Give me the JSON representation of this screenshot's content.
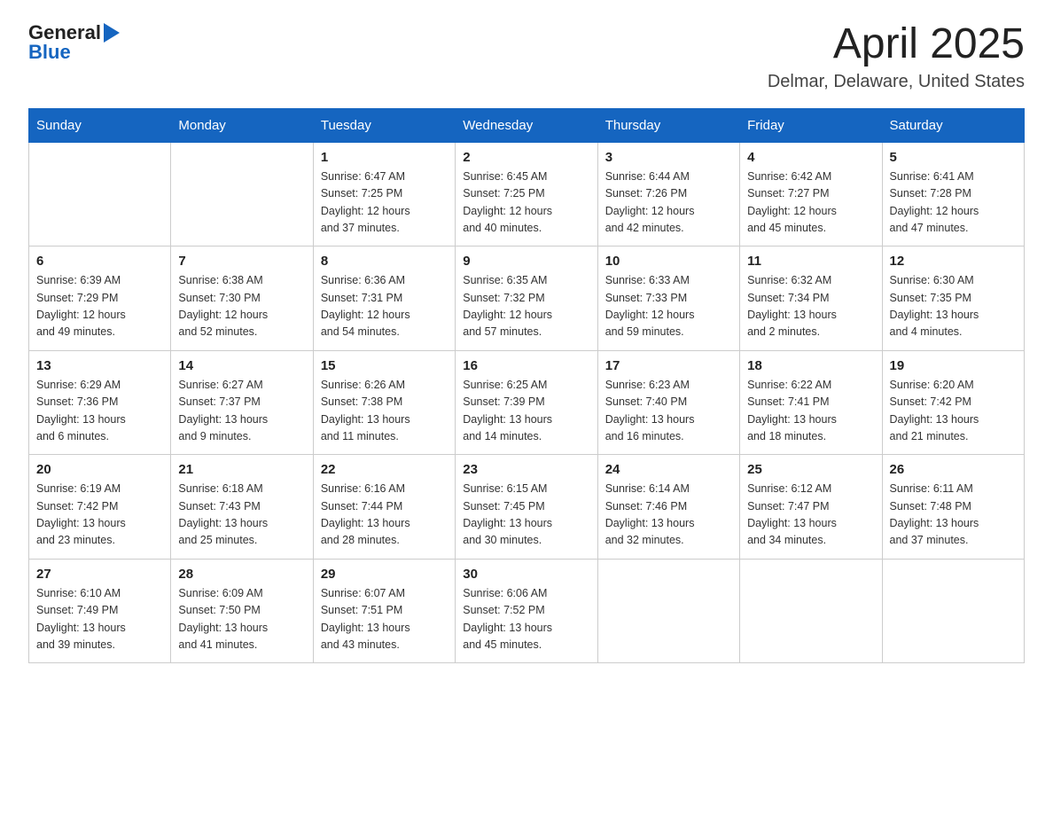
{
  "header": {
    "logo_general": "General",
    "logo_blue": "Blue",
    "month_title": "April 2025",
    "location": "Delmar, Delaware, United States"
  },
  "weekdays": [
    "Sunday",
    "Monday",
    "Tuesday",
    "Wednesday",
    "Thursday",
    "Friday",
    "Saturday"
  ],
  "weeks": [
    [
      {
        "day": "",
        "info": ""
      },
      {
        "day": "",
        "info": ""
      },
      {
        "day": "1",
        "info": "Sunrise: 6:47 AM\nSunset: 7:25 PM\nDaylight: 12 hours\nand 37 minutes."
      },
      {
        "day": "2",
        "info": "Sunrise: 6:45 AM\nSunset: 7:25 PM\nDaylight: 12 hours\nand 40 minutes."
      },
      {
        "day": "3",
        "info": "Sunrise: 6:44 AM\nSunset: 7:26 PM\nDaylight: 12 hours\nand 42 minutes."
      },
      {
        "day": "4",
        "info": "Sunrise: 6:42 AM\nSunset: 7:27 PM\nDaylight: 12 hours\nand 45 minutes."
      },
      {
        "day": "5",
        "info": "Sunrise: 6:41 AM\nSunset: 7:28 PM\nDaylight: 12 hours\nand 47 minutes."
      }
    ],
    [
      {
        "day": "6",
        "info": "Sunrise: 6:39 AM\nSunset: 7:29 PM\nDaylight: 12 hours\nand 49 minutes."
      },
      {
        "day": "7",
        "info": "Sunrise: 6:38 AM\nSunset: 7:30 PM\nDaylight: 12 hours\nand 52 minutes."
      },
      {
        "day": "8",
        "info": "Sunrise: 6:36 AM\nSunset: 7:31 PM\nDaylight: 12 hours\nand 54 minutes."
      },
      {
        "day": "9",
        "info": "Sunrise: 6:35 AM\nSunset: 7:32 PM\nDaylight: 12 hours\nand 57 minutes."
      },
      {
        "day": "10",
        "info": "Sunrise: 6:33 AM\nSunset: 7:33 PM\nDaylight: 12 hours\nand 59 minutes."
      },
      {
        "day": "11",
        "info": "Sunrise: 6:32 AM\nSunset: 7:34 PM\nDaylight: 13 hours\nand 2 minutes."
      },
      {
        "day": "12",
        "info": "Sunrise: 6:30 AM\nSunset: 7:35 PM\nDaylight: 13 hours\nand 4 minutes."
      }
    ],
    [
      {
        "day": "13",
        "info": "Sunrise: 6:29 AM\nSunset: 7:36 PM\nDaylight: 13 hours\nand 6 minutes."
      },
      {
        "day": "14",
        "info": "Sunrise: 6:27 AM\nSunset: 7:37 PM\nDaylight: 13 hours\nand 9 minutes."
      },
      {
        "day": "15",
        "info": "Sunrise: 6:26 AM\nSunset: 7:38 PM\nDaylight: 13 hours\nand 11 minutes."
      },
      {
        "day": "16",
        "info": "Sunrise: 6:25 AM\nSunset: 7:39 PM\nDaylight: 13 hours\nand 14 minutes."
      },
      {
        "day": "17",
        "info": "Sunrise: 6:23 AM\nSunset: 7:40 PM\nDaylight: 13 hours\nand 16 minutes."
      },
      {
        "day": "18",
        "info": "Sunrise: 6:22 AM\nSunset: 7:41 PM\nDaylight: 13 hours\nand 18 minutes."
      },
      {
        "day": "19",
        "info": "Sunrise: 6:20 AM\nSunset: 7:42 PM\nDaylight: 13 hours\nand 21 minutes."
      }
    ],
    [
      {
        "day": "20",
        "info": "Sunrise: 6:19 AM\nSunset: 7:42 PM\nDaylight: 13 hours\nand 23 minutes."
      },
      {
        "day": "21",
        "info": "Sunrise: 6:18 AM\nSunset: 7:43 PM\nDaylight: 13 hours\nand 25 minutes."
      },
      {
        "day": "22",
        "info": "Sunrise: 6:16 AM\nSunset: 7:44 PM\nDaylight: 13 hours\nand 28 minutes."
      },
      {
        "day": "23",
        "info": "Sunrise: 6:15 AM\nSunset: 7:45 PM\nDaylight: 13 hours\nand 30 minutes."
      },
      {
        "day": "24",
        "info": "Sunrise: 6:14 AM\nSunset: 7:46 PM\nDaylight: 13 hours\nand 32 minutes."
      },
      {
        "day": "25",
        "info": "Sunrise: 6:12 AM\nSunset: 7:47 PM\nDaylight: 13 hours\nand 34 minutes."
      },
      {
        "day": "26",
        "info": "Sunrise: 6:11 AM\nSunset: 7:48 PM\nDaylight: 13 hours\nand 37 minutes."
      }
    ],
    [
      {
        "day": "27",
        "info": "Sunrise: 6:10 AM\nSunset: 7:49 PM\nDaylight: 13 hours\nand 39 minutes."
      },
      {
        "day": "28",
        "info": "Sunrise: 6:09 AM\nSunset: 7:50 PM\nDaylight: 13 hours\nand 41 minutes."
      },
      {
        "day": "29",
        "info": "Sunrise: 6:07 AM\nSunset: 7:51 PM\nDaylight: 13 hours\nand 43 minutes."
      },
      {
        "day": "30",
        "info": "Sunrise: 6:06 AM\nSunset: 7:52 PM\nDaylight: 13 hours\nand 45 minutes."
      },
      {
        "day": "",
        "info": ""
      },
      {
        "day": "",
        "info": ""
      },
      {
        "day": "",
        "info": ""
      }
    ]
  ]
}
